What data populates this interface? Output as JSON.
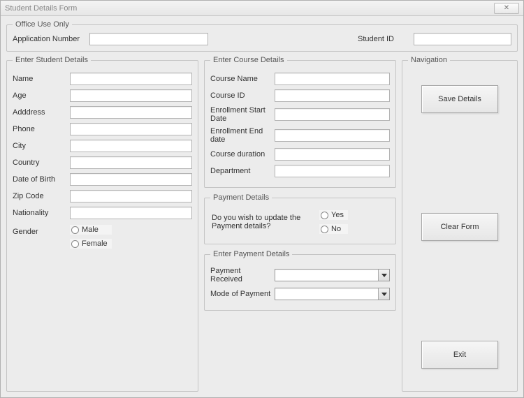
{
  "window": {
    "title": "Student Details Form"
  },
  "office": {
    "legend": "Office Use Only",
    "appnum_label": "Application Number",
    "appnum_value": "",
    "studentid_label": "Student ID",
    "studentid_value": ""
  },
  "student": {
    "legend": "Enter Student Details",
    "fields": {
      "name": {
        "label": "Name",
        "value": ""
      },
      "age": {
        "label": "Age",
        "value": ""
      },
      "address": {
        "label": "Adddress",
        "value": ""
      },
      "phone": {
        "label": "Phone",
        "value": ""
      },
      "city": {
        "label": "City",
        "value": ""
      },
      "country": {
        "label": "Country",
        "value": ""
      },
      "dob": {
        "label": "Date of Birth",
        "value": ""
      },
      "zip": {
        "label": "Zip Code",
        "value": ""
      },
      "nationality": {
        "label": "Nationality",
        "value": ""
      }
    },
    "gender": {
      "label": "Gender",
      "male": "Male",
      "female": "Female"
    }
  },
  "course": {
    "legend": "Enter Course Details",
    "fields": {
      "cname": {
        "label": "Course Name",
        "value": ""
      },
      "cid": {
        "label": "Course ID",
        "value": ""
      },
      "start": {
        "label": "Enrollment Start Date",
        "value": ""
      },
      "end": {
        "label": "Enrollment End date",
        "value": ""
      },
      "duration": {
        "label": "Course duration",
        "value": ""
      },
      "dept": {
        "label": "Department",
        "value": ""
      }
    }
  },
  "payq": {
    "legend": "Payment Details",
    "question": "Do you wish to update the Payment details?",
    "yes": "Yes",
    "no": "No"
  },
  "payd": {
    "legend": "Enter Payment Details",
    "received_label": "Payment Received",
    "received_value": "",
    "mode_label": "Mode of Payment",
    "mode_value": ""
  },
  "nav": {
    "legend": "Navigation",
    "save": "Save Details",
    "clear": "Clear Form",
    "exit": "Exit"
  }
}
